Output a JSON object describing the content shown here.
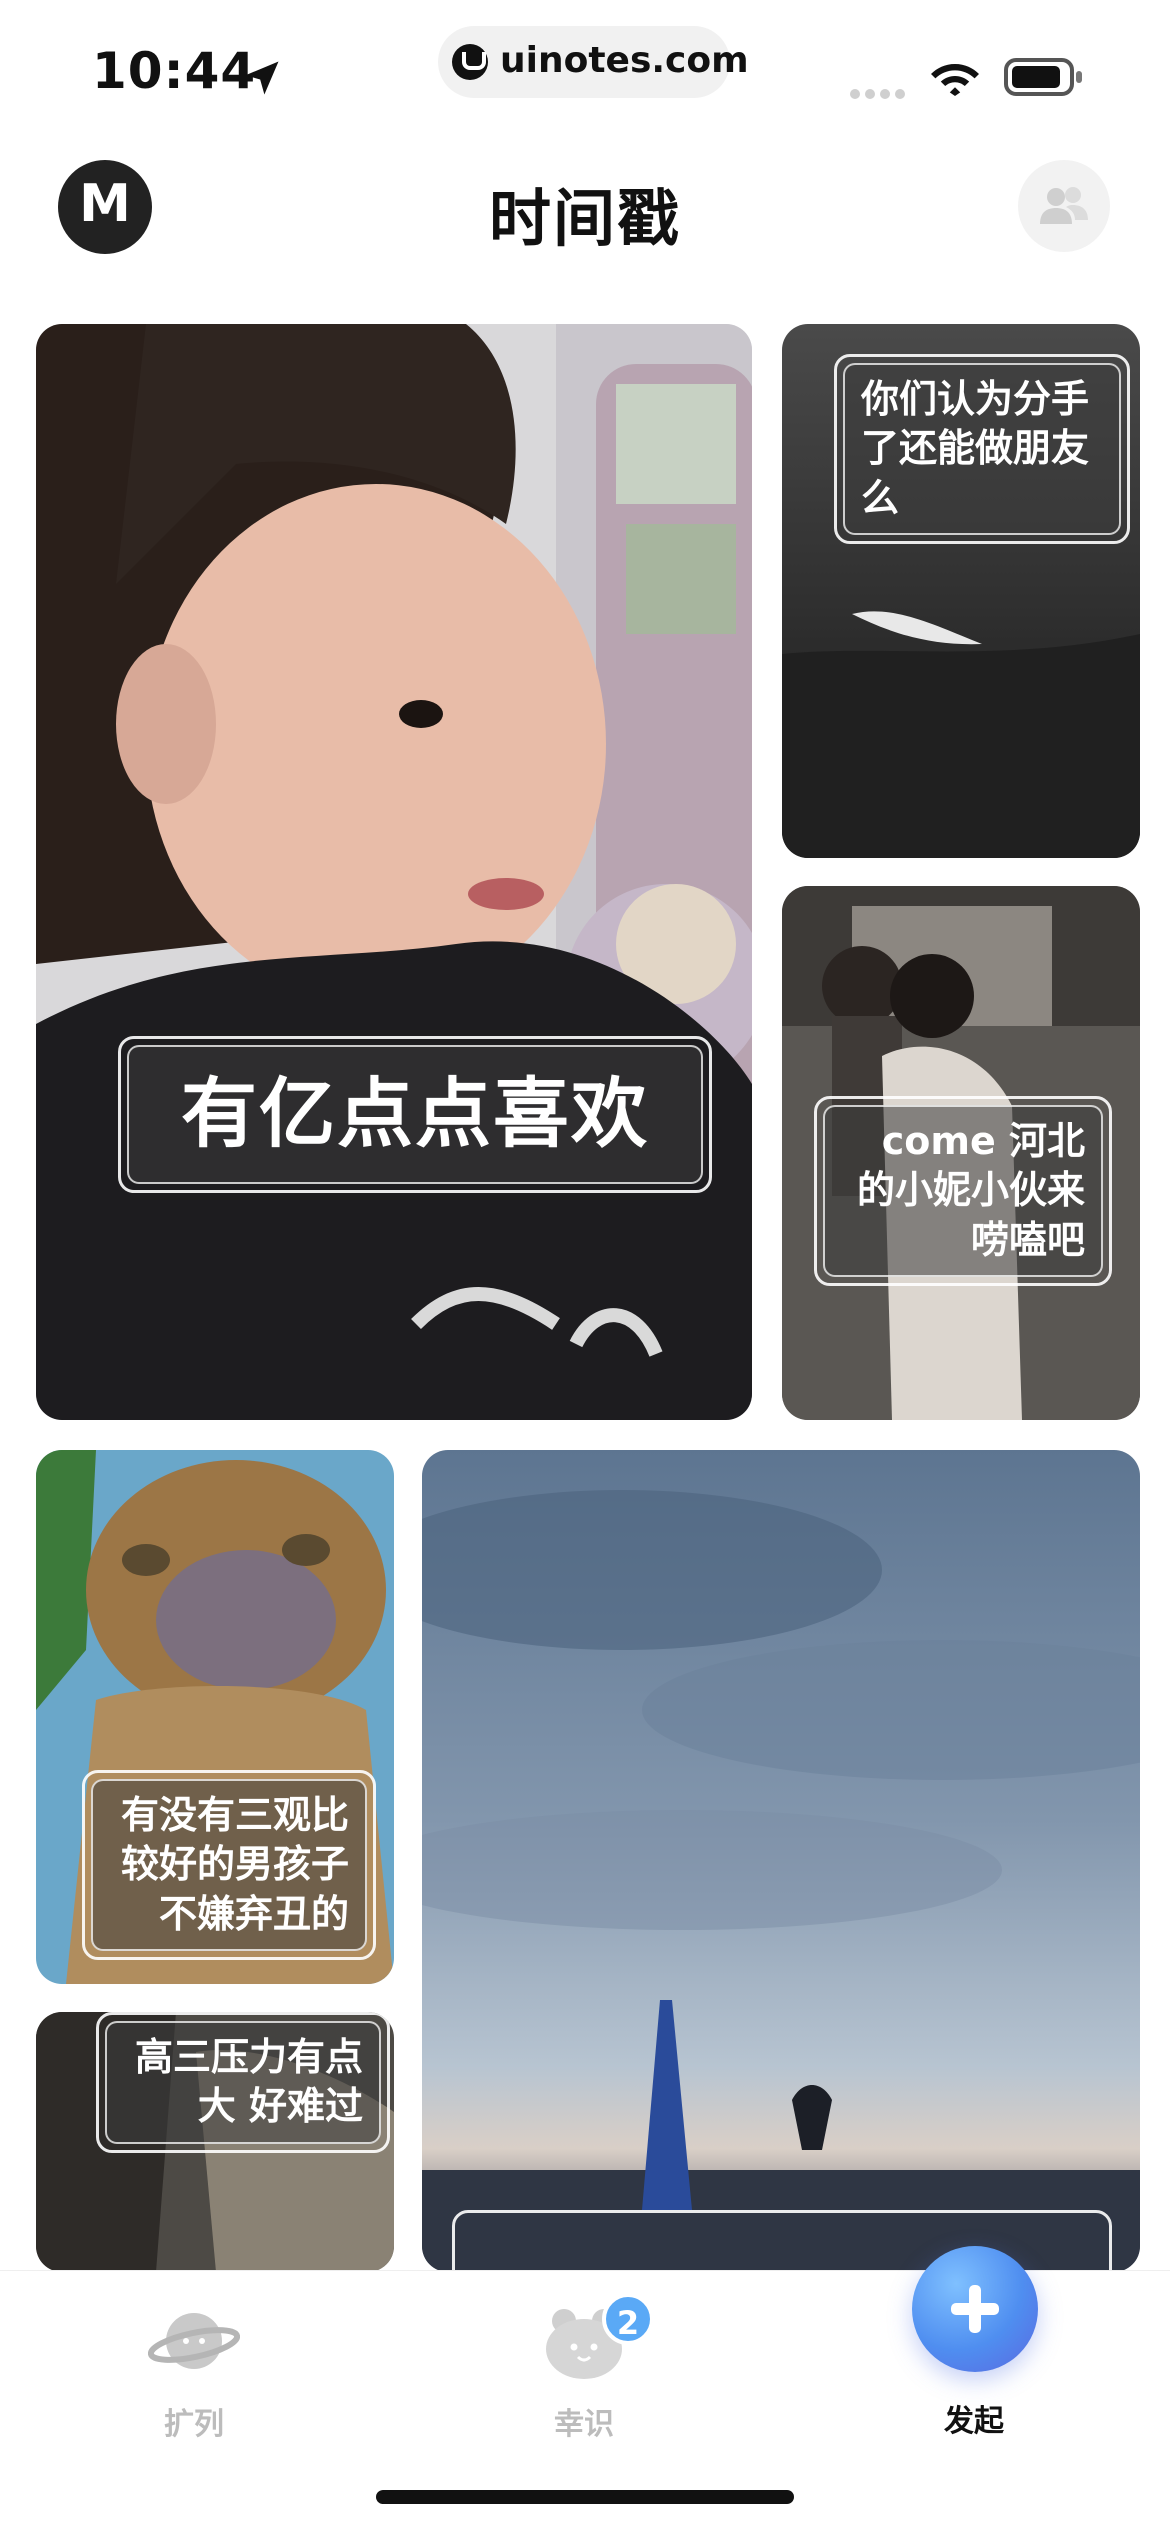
{
  "status_bar": {
    "time": "10:44",
    "url": "uinotes.com"
  },
  "header": {
    "title": "时间戳",
    "avatar_letter": "M"
  },
  "feed": {
    "cards": [
      {
        "caption": "有亿点点喜欢"
      },
      {
        "caption_lines": [
          "你们认为分手",
          "了还能做朋友",
          "么"
        ]
      },
      {
        "caption_lines": [
          "come  河北",
          "的小妮小伙来",
          "唠嗑吧"
        ]
      },
      {
        "caption_lines": [
          "有没有三观比",
          "较好的男孩子",
          "不嫌弃丑的"
        ]
      },
      {
        "caption_lines": [
          "高三压力有点",
          "大 好难过"
        ]
      }
    ]
  },
  "bottom_nav": {
    "items": [
      {
        "label": "扩列",
        "icon": "planet-icon"
      },
      {
        "label": "幸识",
        "icon": "blob-face-icon",
        "badge": "2"
      },
      {
        "label": "发起",
        "icon": "plus-icon"
      }
    ]
  },
  "colors": {
    "accent": "#4f8ef0",
    "badge": "#5aa9f6",
    "inactive_label": "#bcbcbc"
  }
}
